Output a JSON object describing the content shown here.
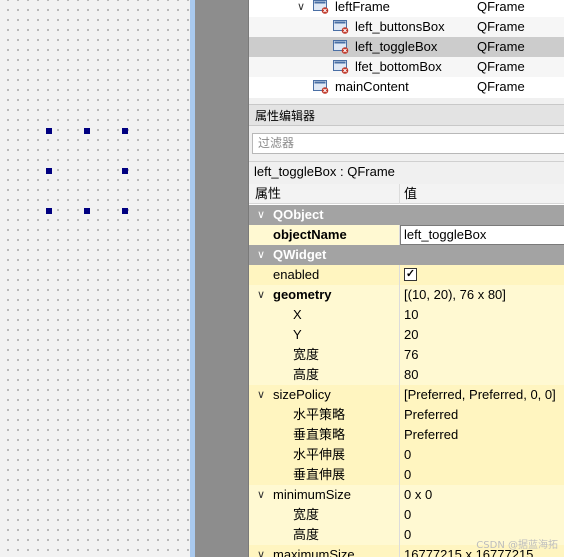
{
  "tree": {
    "items": [
      {
        "name": "leftFrame",
        "cls": "QFrame",
        "expanded": true
      },
      {
        "name": "left_buttonsBox",
        "cls": "QFrame"
      },
      {
        "name": "left_toggleBox",
        "cls": "QFrame",
        "selected": true
      },
      {
        "name": "lfet_bottomBox",
        "cls": "QFrame"
      },
      {
        "name": "mainContent",
        "cls": "QFrame"
      }
    ]
  },
  "property_editor": {
    "title": "属性编辑器",
    "filter_placeholder": "过滤器",
    "object_label": "left_toggleBox : QFrame",
    "header": {
      "property": "属性",
      "value": "值"
    },
    "groups": [
      {
        "name": "QObject"
      },
      {
        "name": "QWidget"
      }
    ],
    "rows": {
      "objectName": {
        "key": "objectName",
        "value": "left_toggleBox"
      },
      "enabled": {
        "key": "enabled",
        "checked": true,
        "mark": "✓"
      },
      "geometry": {
        "key": "geometry",
        "value": "[(10, 20), 76 x 80]"
      },
      "x": {
        "key": "X",
        "value": "10"
      },
      "y": {
        "key": "Y",
        "value": "20"
      },
      "width": {
        "key": "宽度",
        "value": "76"
      },
      "height": {
        "key": "高度",
        "value": "80"
      },
      "sizePolicy": {
        "key": "sizePolicy",
        "value": "[Preferred, Preferred, 0, 0]"
      },
      "hpolicy": {
        "key": "水平策略",
        "value": "Preferred"
      },
      "vpolicy": {
        "key": "垂直策略",
        "value": "Preferred"
      },
      "hstretch": {
        "key": "水平伸展",
        "value": "0"
      },
      "vstretch": {
        "key": "垂直伸展",
        "value": "0"
      },
      "minimumSize": {
        "key": "minimumSize",
        "value": "0 x 0"
      },
      "minWidth": {
        "key": "宽度",
        "value": "0"
      },
      "minHeight": {
        "key": "高度",
        "value": "0"
      },
      "maximumSize": {
        "key": "maximumSize",
        "value": "16777215 x 16777215"
      }
    }
  },
  "watermark": "CSDN @据蓝海拓",
  "colors": {
    "selection_handle": "#000080",
    "group_row": "#a3a3a3",
    "property_row": "#fff9d2",
    "selected_tree_row": "#cccccc"
  }
}
